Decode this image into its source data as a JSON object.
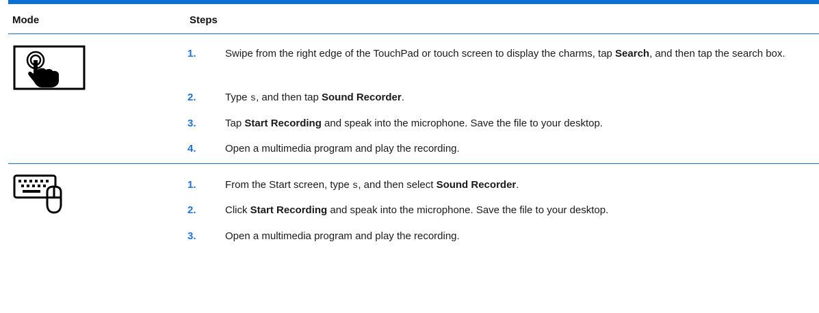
{
  "table": {
    "header": {
      "mode": "Mode",
      "steps": "Steps"
    },
    "touch_row": {
      "icon": "touch-gesture-icon",
      "steps": [
        {
          "number": "1.",
          "part1": "Swipe from the right edge of the TouchPad or touch screen to display the charms, tap ",
          "bold1": "Search",
          "part2": ", and then tap the search box."
        },
        {
          "number": "2.",
          "part1": "Type ",
          "code1": "s",
          "part2": ", and then tap ",
          "bold1": "Sound Recorder",
          "part3": "."
        },
        {
          "number": "3.",
          "part1": "Tap ",
          "bold1": "Start Recording",
          "part2": " and speak into the microphone. Save the file to your desktop."
        },
        {
          "number": "4.",
          "part1": "Open a multimedia program and play the recording."
        }
      ]
    },
    "keyboard_row": {
      "icon": "keyboard-mouse-icon",
      "steps": [
        {
          "number": "1.",
          "part1": "From the Start screen, type ",
          "code1": "s",
          "part2": ", and then select ",
          "bold1": "Sound Recorder",
          "part3": "."
        },
        {
          "number": "2.",
          "part1": "Click ",
          "bold1": "Start Recording",
          "part2": " and speak into the microphone. Save the file to your desktop."
        },
        {
          "number": "3.",
          "part1": "Open a multimedia program and play the recording."
        }
      ]
    },
    "colors": {
      "accent_blue": "#0c6fd1",
      "step_number_blue": "#1e73d8",
      "text": "#1a1a1a"
    }
  }
}
